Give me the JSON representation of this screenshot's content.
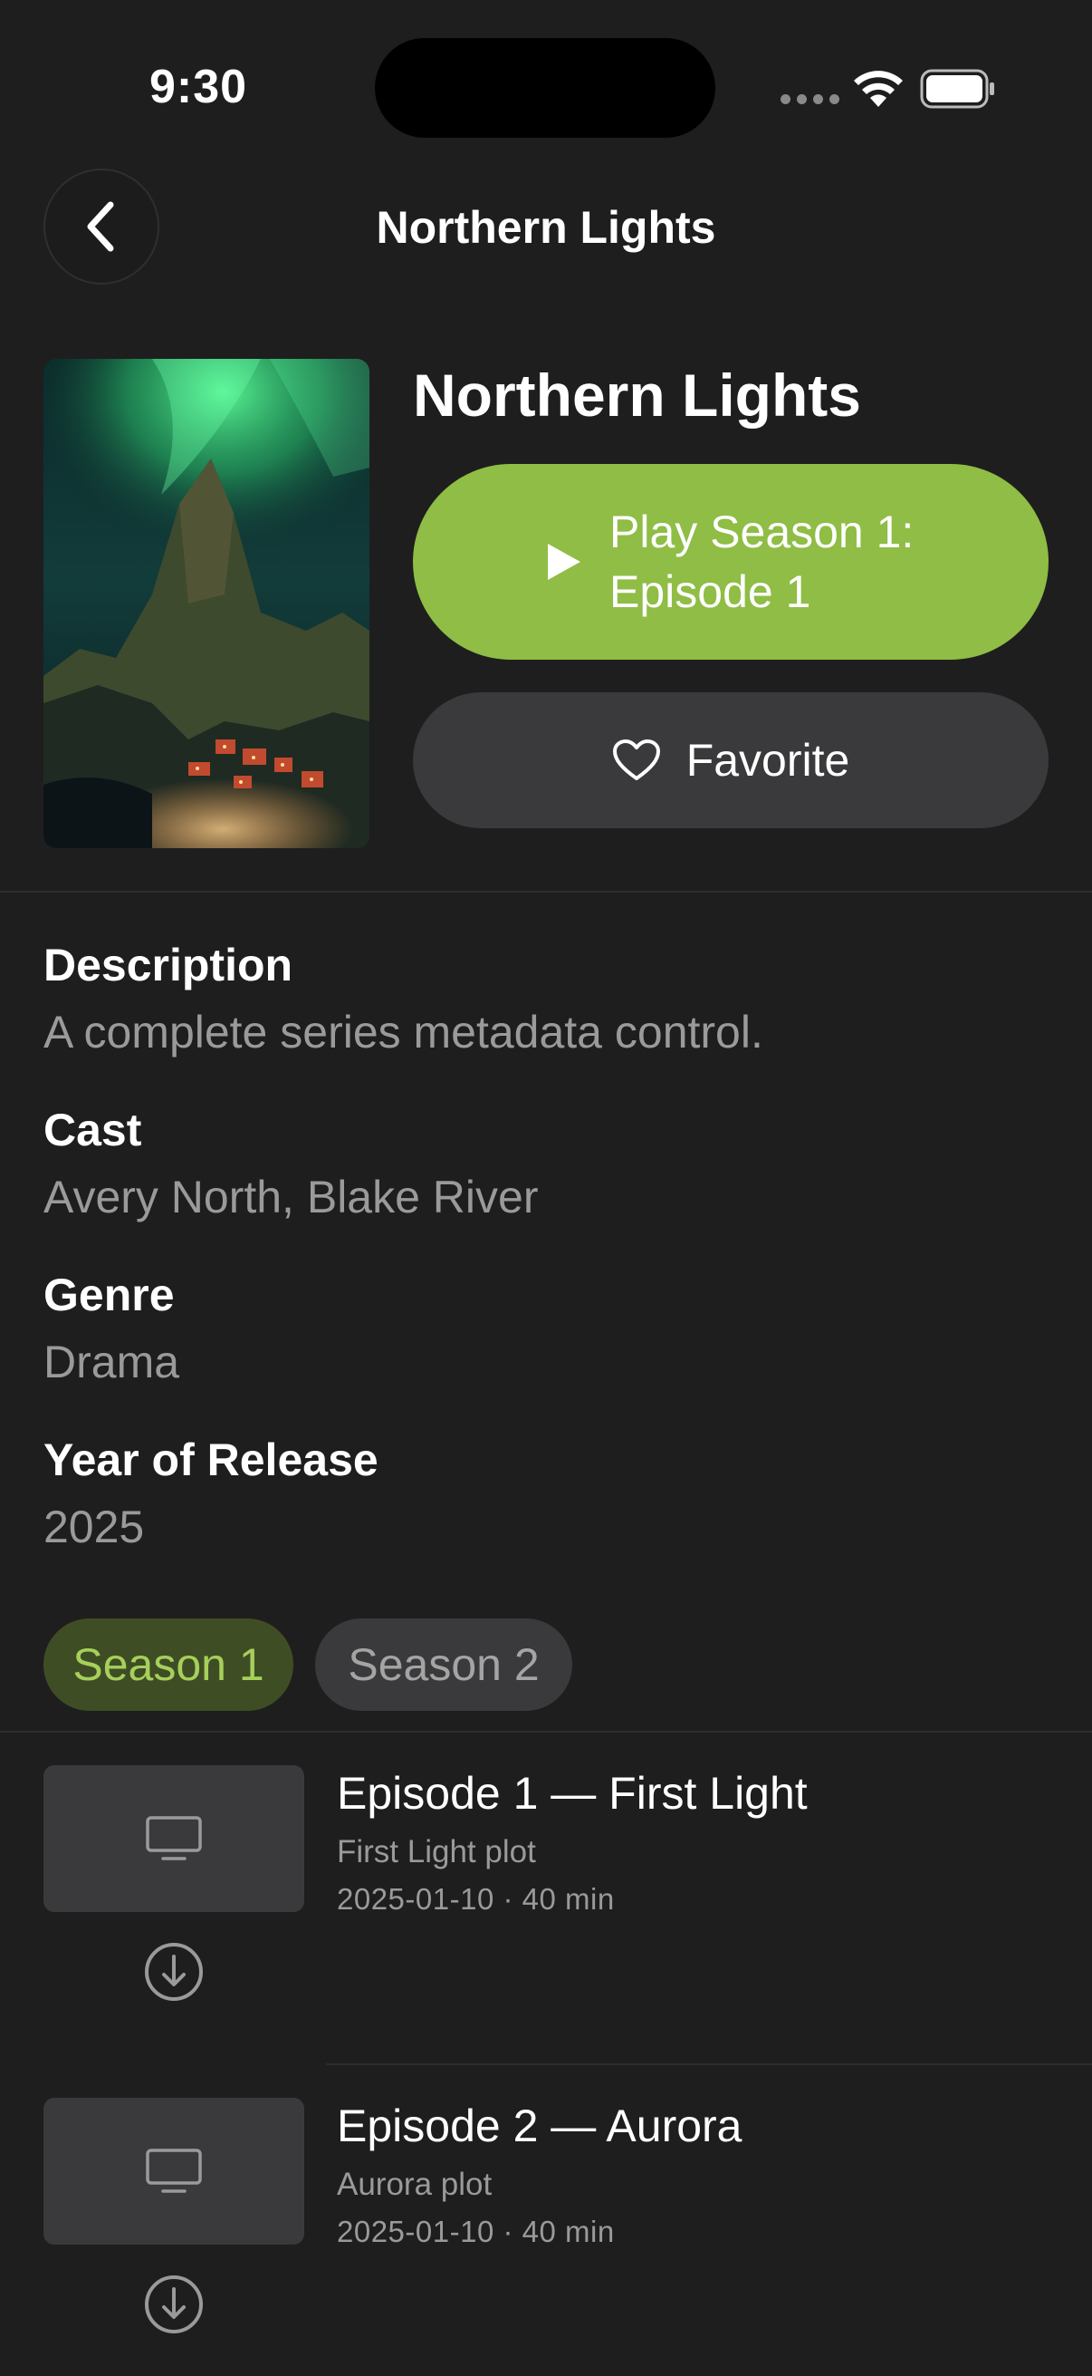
{
  "status_bar": {
    "time": "9:30"
  },
  "nav": {
    "title": "Northern Lights"
  },
  "show": {
    "title": "Northern Lights",
    "play_label": "Play Season 1: Episode 1",
    "favorite_label": "Favorite"
  },
  "details": [
    {
      "label": "Description",
      "value": "A complete series metadata control."
    },
    {
      "label": "Cast",
      "value": "Avery North, Blake River"
    },
    {
      "label": "Genre",
      "value": "Drama"
    },
    {
      "label": "Year of Release",
      "value": "2025"
    }
  ],
  "seasons": [
    {
      "label": "Season 1",
      "selected": true
    },
    {
      "label": "Season 2",
      "selected": false
    }
  ],
  "episodes": [
    {
      "title": "Episode 1 — First Light",
      "plot": "First Light plot",
      "meta": "2025-01-10 · 40 min"
    },
    {
      "title": "Episode 2 — Aurora",
      "plot": "Aurora plot",
      "meta": "2025-01-10 · 40 min"
    }
  ],
  "colors": {
    "accent": "#8fbd45",
    "background": "#1e1e1e",
    "button_gray": "#3a3a3c"
  },
  "icons": {
    "back": "chevron-left-icon",
    "play": "play-icon",
    "favorite": "heart-outline-icon",
    "episode_thumb": "tv-icon",
    "download": "download-circle-icon"
  }
}
